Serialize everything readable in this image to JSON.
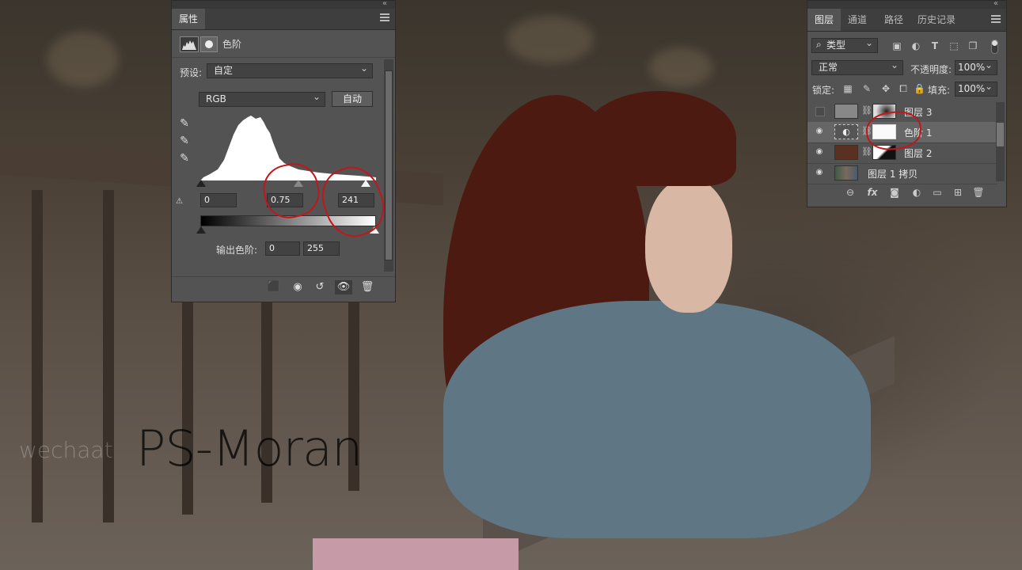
{
  "canvas": {
    "watermark_small": "wechaat",
    "watermark_big": "PS-Moran"
  },
  "properties_panel": {
    "tab": "属性",
    "title": "色阶",
    "preset_label": "预设:",
    "preset_value": "自定",
    "channel_value": "RGB",
    "auto_button": "自动",
    "input_black": "0",
    "input_gamma": "0.75",
    "input_white": "241",
    "output_label": "输出色阶:",
    "output_black": "0",
    "output_white": "255",
    "icons": [
      "levels-icon",
      "mask-icon",
      "eyedropper-black-icon",
      "eyedropper-gray-icon",
      "eyedropper-white-icon",
      "warning-icon",
      "clip-icon",
      "view-previous-icon",
      "reset-icon",
      "visibility-icon",
      "trash-icon",
      "panel-menu-icon"
    ]
  },
  "layers_panel": {
    "tabs": [
      "图层",
      "通道",
      "路径",
      "历史记录"
    ],
    "filter_value": "类型",
    "blend_mode": "正常",
    "opacity_label": "不透明度:",
    "opacity_value": "100%",
    "lock_label": "锁定:",
    "fill_label": "填充:",
    "fill_value": "100%",
    "layers": [
      {
        "name": "图层 3",
        "visible": false
      },
      {
        "name": "色阶 1",
        "visible": true,
        "selected": true
      },
      {
        "name": "图层 2",
        "visible": true
      },
      {
        "name": "图层 1 拷贝",
        "visible": true
      }
    ],
    "bottom_icons": [
      "link-icon",
      "fx-icon",
      "add-mask-icon",
      "adjustment-icon",
      "folder-icon",
      "new-layer-icon",
      "trash-icon"
    ],
    "colors": {
      "layer2_thumb": "#5a3020",
      "panel_bg": "#535353"
    }
  }
}
